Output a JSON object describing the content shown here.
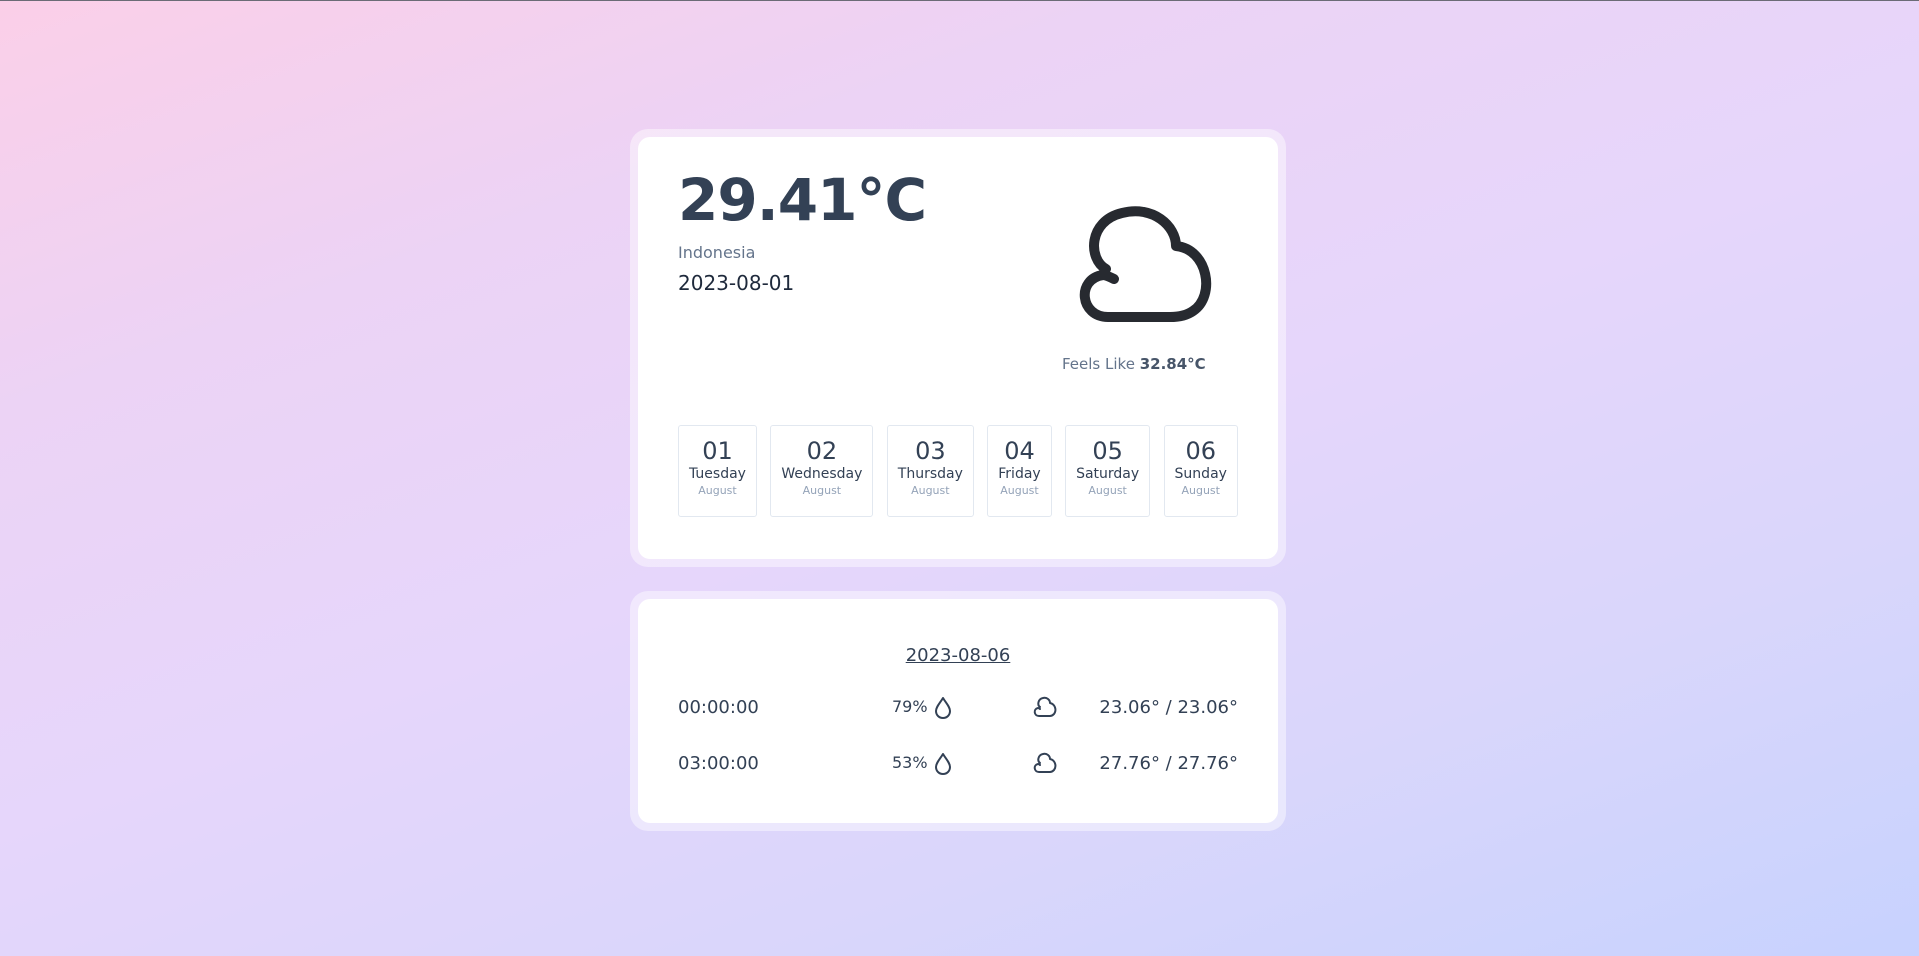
{
  "current": {
    "temperature": "29.41°C",
    "location": "Indonesia",
    "date": "2023-08-01",
    "icon": "cloud-icon",
    "feels_like_label": "Feels Like",
    "feels_like_value": "32.84°C"
  },
  "forecast_days": [
    {
      "day": "01",
      "weekday": "Tuesday",
      "month": "August"
    },
    {
      "day": "02",
      "weekday": "Wednesday",
      "month": "August"
    },
    {
      "day": "03",
      "weekday": "Thursday",
      "month": "August"
    },
    {
      "day": "04",
      "weekday": "Friday",
      "month": "August"
    },
    {
      "day": "05",
      "weekday": "Saturday",
      "month": "August"
    },
    {
      "day": "06",
      "weekday": "Sunday",
      "month": "August"
    }
  ],
  "detail": {
    "date": "2023-08-06",
    "rows": [
      {
        "time": "00:00:00",
        "humidity": "79%",
        "humidity_icon": "droplet-icon",
        "weather_icon": "cloud-icon",
        "range": "23.06° / 23.06°"
      },
      {
        "time": "03:00:00",
        "humidity": "53%",
        "humidity_icon": "droplet-icon",
        "weather_icon": "cloud-icon",
        "range": "27.76° / 27.76°"
      }
    ]
  }
}
